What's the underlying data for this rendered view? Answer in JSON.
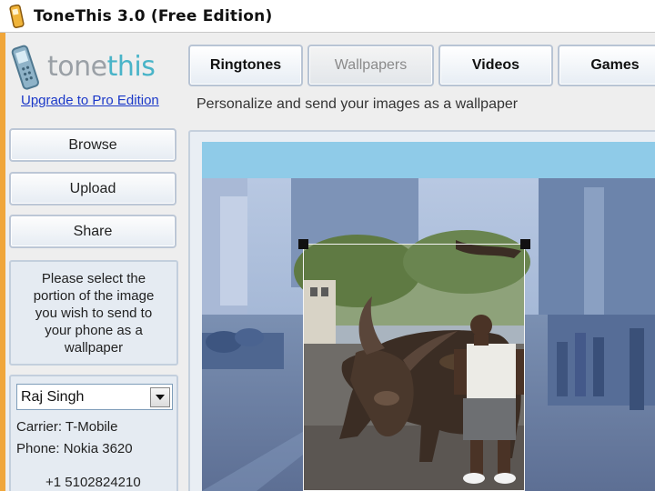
{
  "window": {
    "title": "ToneThis 3.0 (Free Edition)"
  },
  "logo": {
    "tone": "tone",
    "this": "this"
  },
  "upgrade_link": "Upgrade to Pro Edition",
  "sidebar": {
    "buttons": [
      {
        "label": "Browse"
      },
      {
        "label": "Upload"
      },
      {
        "label": "Share"
      }
    ],
    "instruction": "Please select the portion of the image you wish to send to your phone as a wallpaper"
  },
  "account": {
    "selected_contact": "Raj Singh",
    "carrier": "Carrier: T-Mobile",
    "phone": "Phone:  Nokia 3620",
    "number": "+1 5102824210"
  },
  "tabs": [
    {
      "label": "Ringtones",
      "active": false
    },
    {
      "label": "Wallpapers",
      "active": true
    },
    {
      "label": "Videos",
      "active": false
    },
    {
      "label": "Games",
      "active": false
    }
  ],
  "subtitle": "Personalize and send your images as a wallpaper",
  "colors": {
    "frame_orange": "#f0a63a",
    "header_blue": "#8fcbe8",
    "link_blue": "#1b38c8",
    "brand_gray": "#9aa0a6",
    "brand_teal": "#49b4c8"
  },
  "icons": [
    "app-phone-icon",
    "logo-phone-icon",
    "dropdown-arrow-icon"
  ]
}
